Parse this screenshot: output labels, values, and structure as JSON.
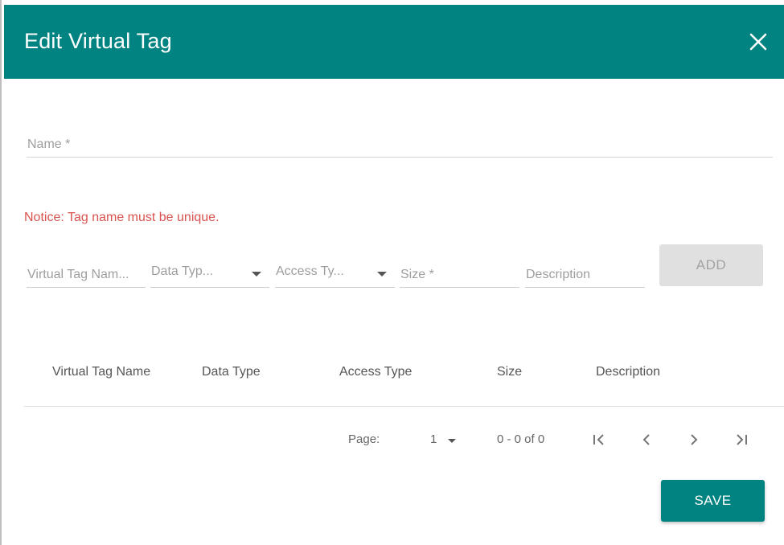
{
  "dialog": {
    "title": "Edit Virtual Tag",
    "close_icon": "close-icon"
  },
  "form": {
    "name_placeholder": "Name *",
    "name_value": "",
    "notice": "Notice: Tag name must be unique."
  },
  "tag_entry": {
    "virtual_tag_name_placeholder": "Virtual Tag Nam...",
    "data_type_placeholder": "Data Typ...",
    "access_type_placeholder": "Access Ty...",
    "size_placeholder": "Size *",
    "description_placeholder": "Description",
    "add_label": "ADD",
    "dropdown_icon": "caret-down-icon"
  },
  "table": {
    "columns": [
      "Virtual Tag Name",
      "Data Type",
      "Access Type",
      "Size",
      "Description"
    ],
    "rows": []
  },
  "pagination": {
    "page_label": "Page:",
    "current_page": "1",
    "range_text": "0 - 0 of 0",
    "icons": [
      "first-page-icon",
      "previous-page-icon",
      "next-page-icon",
      "last-page-icon"
    ]
  },
  "footer": {
    "save_label": "SAVE"
  },
  "colors": {
    "header_bg": "#008381",
    "notice_text": "#d9534f",
    "disabled_button_bg": "#e0e0e0",
    "primary_button_bg": "#008381"
  }
}
